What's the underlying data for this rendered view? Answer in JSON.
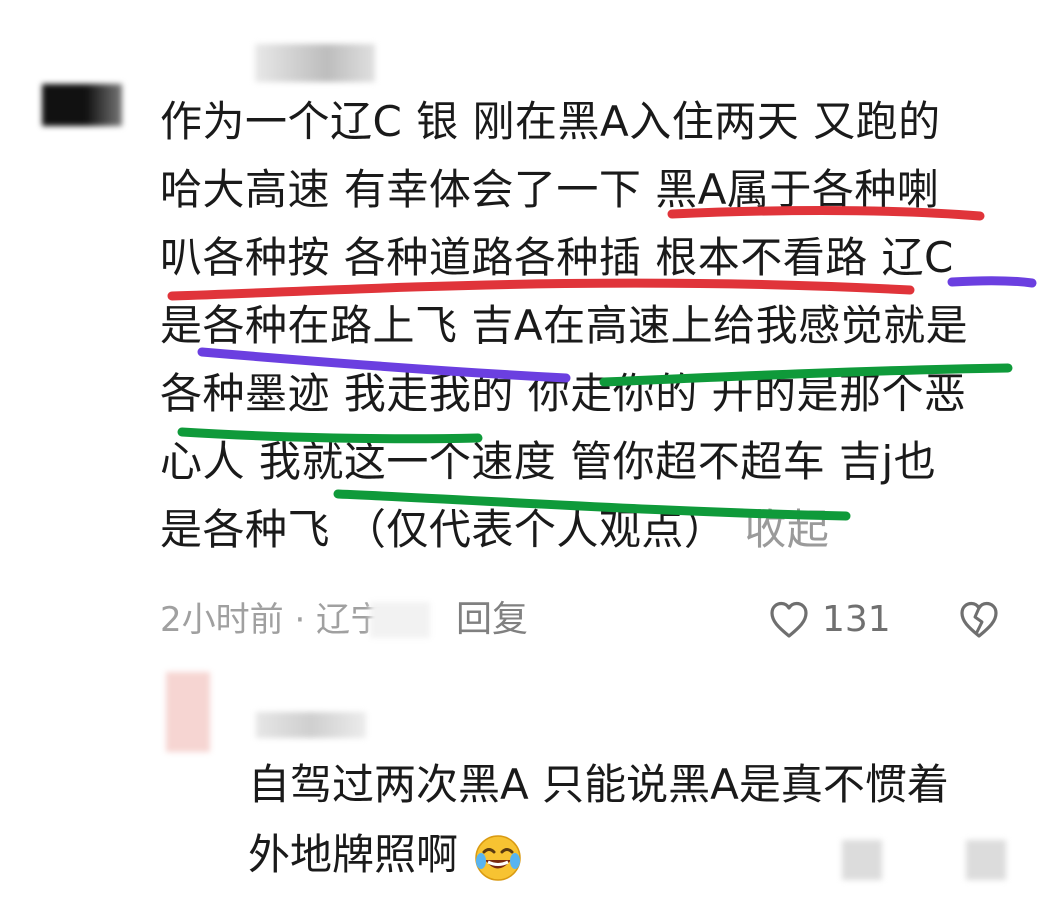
{
  "comment": {
    "lines": [
      "作为一个辽C 银 刚在黑A入住两天 又跑的",
      "哈大高速 有幸体会了一下 黑A属于各种喇",
      "叭各种按 各种道路各种插 根本不看路 辽C",
      "是各种在路上飞 吉A在高速上给我感觉就是",
      "各种墨迹 我走我的 你走你的 开的是那个恶",
      "心人 我就这一个速度 管你超不超车  吉j也",
      "是各种飞 （仅代表个人观点）"
    ],
    "collapse_label": "收起",
    "meta": "2小时前 · 辽宁",
    "reply_label": "回复",
    "like_count": "131",
    "icons": {
      "like": "heart-icon",
      "dislike": "broken-heart-icon"
    }
  },
  "reply": {
    "lines": [
      "自驾过两次黑A   只能说黑A是真不惯着",
      "外地牌照啊"
    ],
    "emoji": "laughing-crying-emoji"
  },
  "colors": {
    "red_mark": "#e0343a",
    "purple_mark": "#6b3fe0",
    "green_mark": "#0f9a3a"
  }
}
